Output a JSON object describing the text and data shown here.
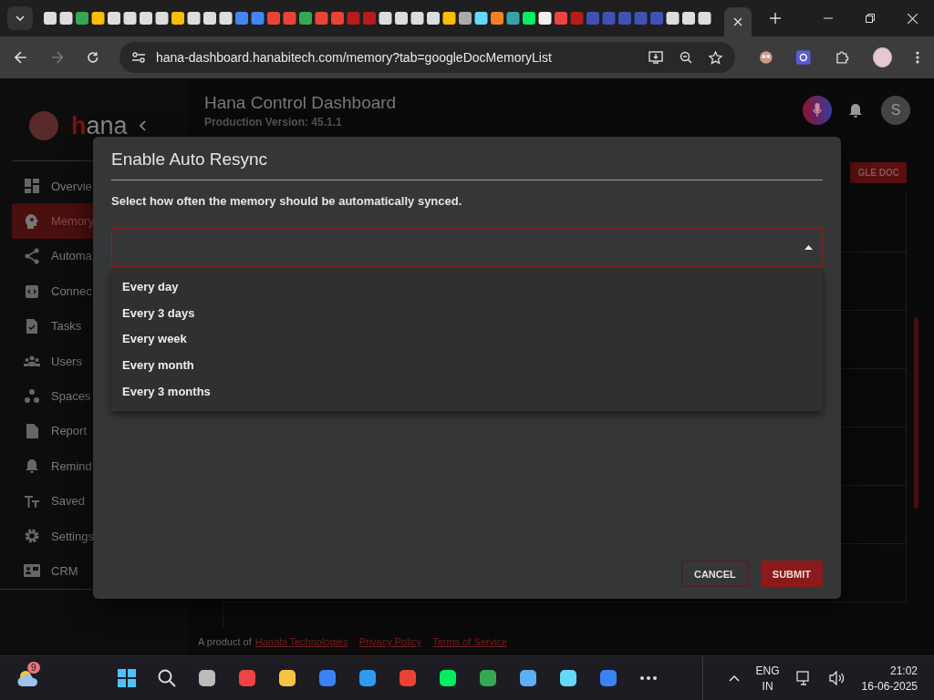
{
  "browser": {
    "url": "hana-dashboard.hanabitech.com/memory?tab=googleDocMemoryList"
  },
  "sidebar": {
    "items": [
      {
        "label": "Overvie",
        "selected": false
      },
      {
        "label": "Memory",
        "selected": true
      },
      {
        "label": "Automa",
        "selected": false
      },
      {
        "label": "Connec",
        "selected": false
      },
      {
        "label": "Tasks",
        "selected": false
      },
      {
        "label": "Users",
        "selected": false
      },
      {
        "label": "Spaces",
        "selected": false
      },
      {
        "label": "Report",
        "selected": false
      },
      {
        "label": "Remind",
        "selected": false
      },
      {
        "label": "Saved",
        "selected": false
      },
      {
        "label": "Settings",
        "selected": false
      },
      {
        "label": "CRM",
        "selected": false
      }
    ],
    "logo": "hana"
  },
  "header": {
    "title": "Hana Control Dashboard",
    "subtitle": "Production Version: 45.1.1",
    "avatar": "S"
  },
  "background_button": "GLE DOC",
  "footer": {
    "text": "A product of",
    "links": [
      "Hanabi Technologies",
      "Privacy Policy",
      "Terms of Service"
    ]
  },
  "dialog": {
    "title": "Enable Auto Resync",
    "description": "Select how often the memory should be automatically synced.",
    "select": {
      "expanded": true,
      "options": [
        {
          "label": "Every day",
          "selected": false
        },
        {
          "label": "Every 3 days",
          "selected": false
        },
        {
          "label": "Every week",
          "selected": false
        },
        {
          "label": "Every month",
          "selected": false
        },
        {
          "label": "Every 3 months",
          "selected": false
        }
      ]
    },
    "buttons": [
      {
        "label": "CANCEL",
        "kind": "outlined"
      },
      {
        "label": "SUBMIT",
        "kind": "filled"
      }
    ]
  },
  "taskbar": {
    "weather_badge": "9",
    "language": "ENG",
    "region": "IN",
    "time": "21:02",
    "date": "16-06-2025"
  }
}
